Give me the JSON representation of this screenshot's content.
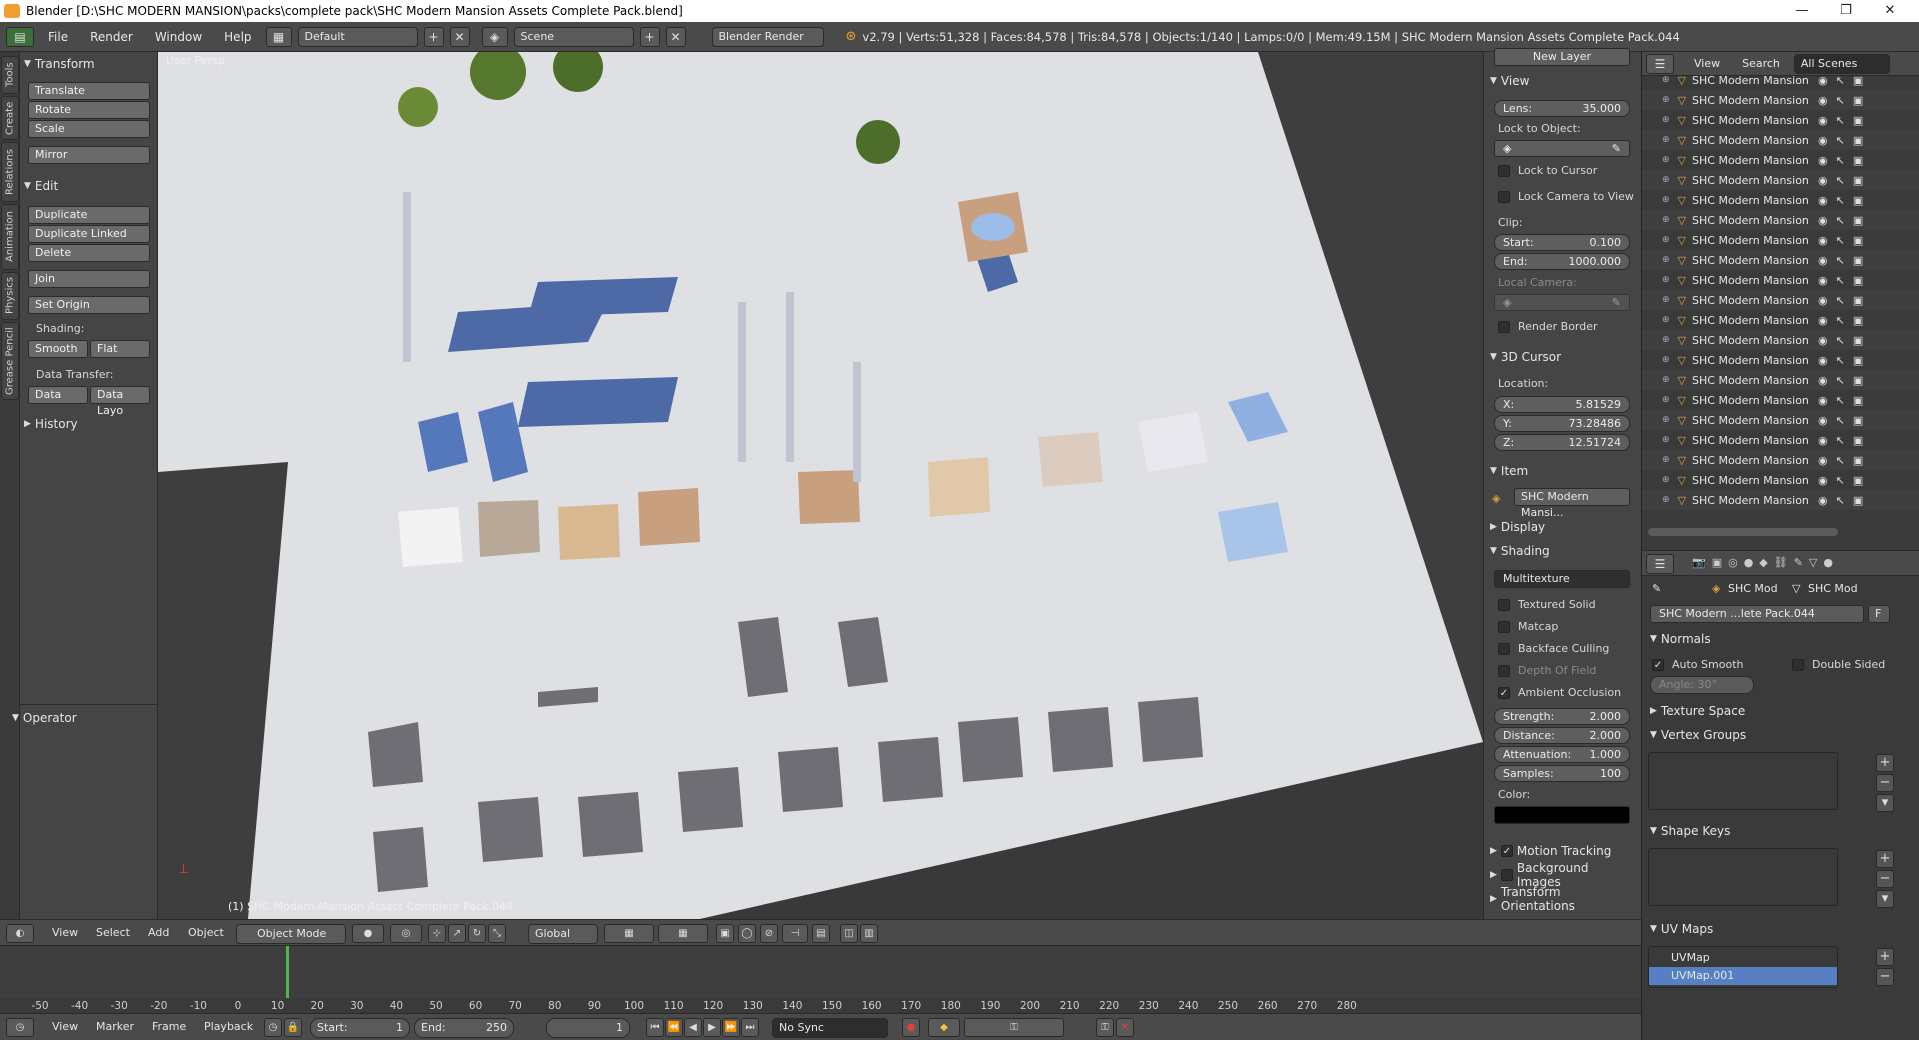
{
  "window": {
    "title": "Blender [D:\\SHC MODERN MANSION\\packs\\complete pack\\SHC Modern Mansion Assets Complete Pack.blend]",
    "minimize": "—",
    "maximize": "❐",
    "close": "✕"
  },
  "info_header": {
    "menus": [
      "File",
      "Render",
      "Window",
      "Help"
    ],
    "layout": "Default",
    "scene": "Scene",
    "engine": "Blender Render",
    "stats": "v2.79 | Verts:51,328 | Faces:84,578 | Tris:84,578 | Objects:1/140 | Lamps:0/0 | Mem:49.15M | SHC Modern Mansion Assets Complete Pack.044"
  },
  "tool_tabs": [
    "Tools",
    "Create",
    "Relations",
    "Animation",
    "Physics",
    "Grease Pencil"
  ],
  "tool_panel": {
    "transform_title": "Transform",
    "transform_buttons": [
      "Translate",
      "Rotate",
      "Scale"
    ],
    "mirror": "Mirror",
    "edit_title": "Edit",
    "edit_buttons": [
      "Duplicate",
      "Duplicate Linked",
      "Delete"
    ],
    "join": "Join",
    "set_origin": "Set Origin",
    "shading_label": "Shading:",
    "smooth": "Smooth",
    "flat": "Flat",
    "data_transfer_label": "Data Transfer:",
    "data": "Data",
    "data_layo": "Data Layo",
    "history": "History",
    "operator": "Operator"
  },
  "viewport": {
    "view_label": "User Persp",
    "object_label": "(1) SHC Modern Mansion Assets Complete Pack.044"
  },
  "n_panel": {
    "new_layer": "New Layer",
    "view_title": "View",
    "lens_label": "Lens:",
    "lens_value": "35.000",
    "lock_to_object": "Lock to Object:",
    "lock_to_cursor": "Lock to Cursor",
    "lock_camera": "Lock Camera to View",
    "clip_label": "Clip:",
    "clip_start_label": "Start:",
    "clip_start": "0.100",
    "clip_end_label": "End:",
    "clip_end": "1000.000",
    "local_camera": "Local Camera:",
    "render_border": "Render Border",
    "cursor_title": "3D Cursor",
    "location_label": "Location:",
    "x_label": "X:",
    "x": "5.81529",
    "y_label": "Y:",
    "y": "73.28486",
    "z_label": "Z:",
    "z": "12.51724",
    "item_title": "Item",
    "item_name": "SHC Modern Mansi...",
    "display_title": "Display",
    "shading_title": "Shading",
    "shading_mode": "Multitexture",
    "textured_solid": "Textured Solid",
    "matcap": "Matcap",
    "backface": "Backface Culling",
    "dof": "Depth Of Field",
    "ao": "Ambient Occlusion",
    "strength_label": "Strength:",
    "strength": "2.000",
    "distance_label": "Distance:",
    "distance": "2.000",
    "attenuation_label": "Attenuation:",
    "attenuation": "1.000",
    "samples_label": "Samples:",
    "samples": "100",
    "color_label": "Color:",
    "motion_tracking": "Motion Tracking",
    "background_images": "Background Images",
    "transform_orientations": "Transform Orientations"
  },
  "outliner": {
    "view": "View",
    "search": "Search",
    "scenes": "All Scenes",
    "items": [
      "SHC Modern Mansion",
      "SHC Modern Mansion A",
      "SHC Modern Mansion A",
      "SHC Modern Mansion A",
      "SHC Modern Mansion A",
      "SHC Modern Mansion A",
      "SHC Modern Mansion A",
      "SHC Modern Mansion A",
      "SHC Modern Mansion A",
      "SHC Modern Mansion A",
      "SHC Modern Mansion A",
      "SHC Modern Mansion A",
      "SHC Modern Mansion A",
      "SHC Modern Mansion A",
      "SHC Modern Mansion A",
      "SHC Modern Mansion A",
      "SHC Modern Mansion A",
      "SHC Modern Mansion A",
      "SHC Modern Mansion A",
      "SHC Modern Mansion A",
      "SHC Modern Mansion A",
      "SHC Modern Mansion A"
    ]
  },
  "properties": {
    "crumb_obj": "SHC Mod",
    "crumb_mesh": "SHC Mod",
    "mesh_name": "SHC Modern ...lete Pack.044",
    "fake_user": "F",
    "normals_title": "Normals",
    "auto_smooth": "Auto Smooth",
    "double_sided": "Double Sided",
    "angle": "Angle:   30°",
    "texture_space": "Texture Space",
    "vertex_groups": "Vertex Groups",
    "shape_keys": "Shape Keys",
    "uv_maps_title": "UV Maps",
    "uv_maps": [
      "UVMap",
      "UVMap.001"
    ]
  },
  "viewport_header": {
    "view": "View",
    "select": "Select",
    "add": "Add",
    "object": "Object",
    "mode": "Object Mode",
    "orientation": "Global"
  },
  "timeline": {
    "ticks": [
      "-50",
      "-40",
      "-30",
      "-20",
      "-10",
      "0",
      "10",
      "20",
      "30",
      "40",
      "50",
      "60",
      "70",
      "80",
      "90",
      "100",
      "110",
      "120",
      "130",
      "140",
      "150",
      "160",
      "170",
      "180",
      "190",
      "200",
      "210",
      "220",
      "230",
      "240",
      "250",
      "260",
      "270",
      "280"
    ],
    "current_frame_pos": 0
  },
  "timeline_header": {
    "view": "View",
    "marker": "Marker",
    "frame": "Frame",
    "playback": "Playback",
    "start_label": "Start:",
    "start": "1",
    "end_label": "End:",
    "end": "250",
    "current": "1",
    "sync": "No Sync"
  }
}
